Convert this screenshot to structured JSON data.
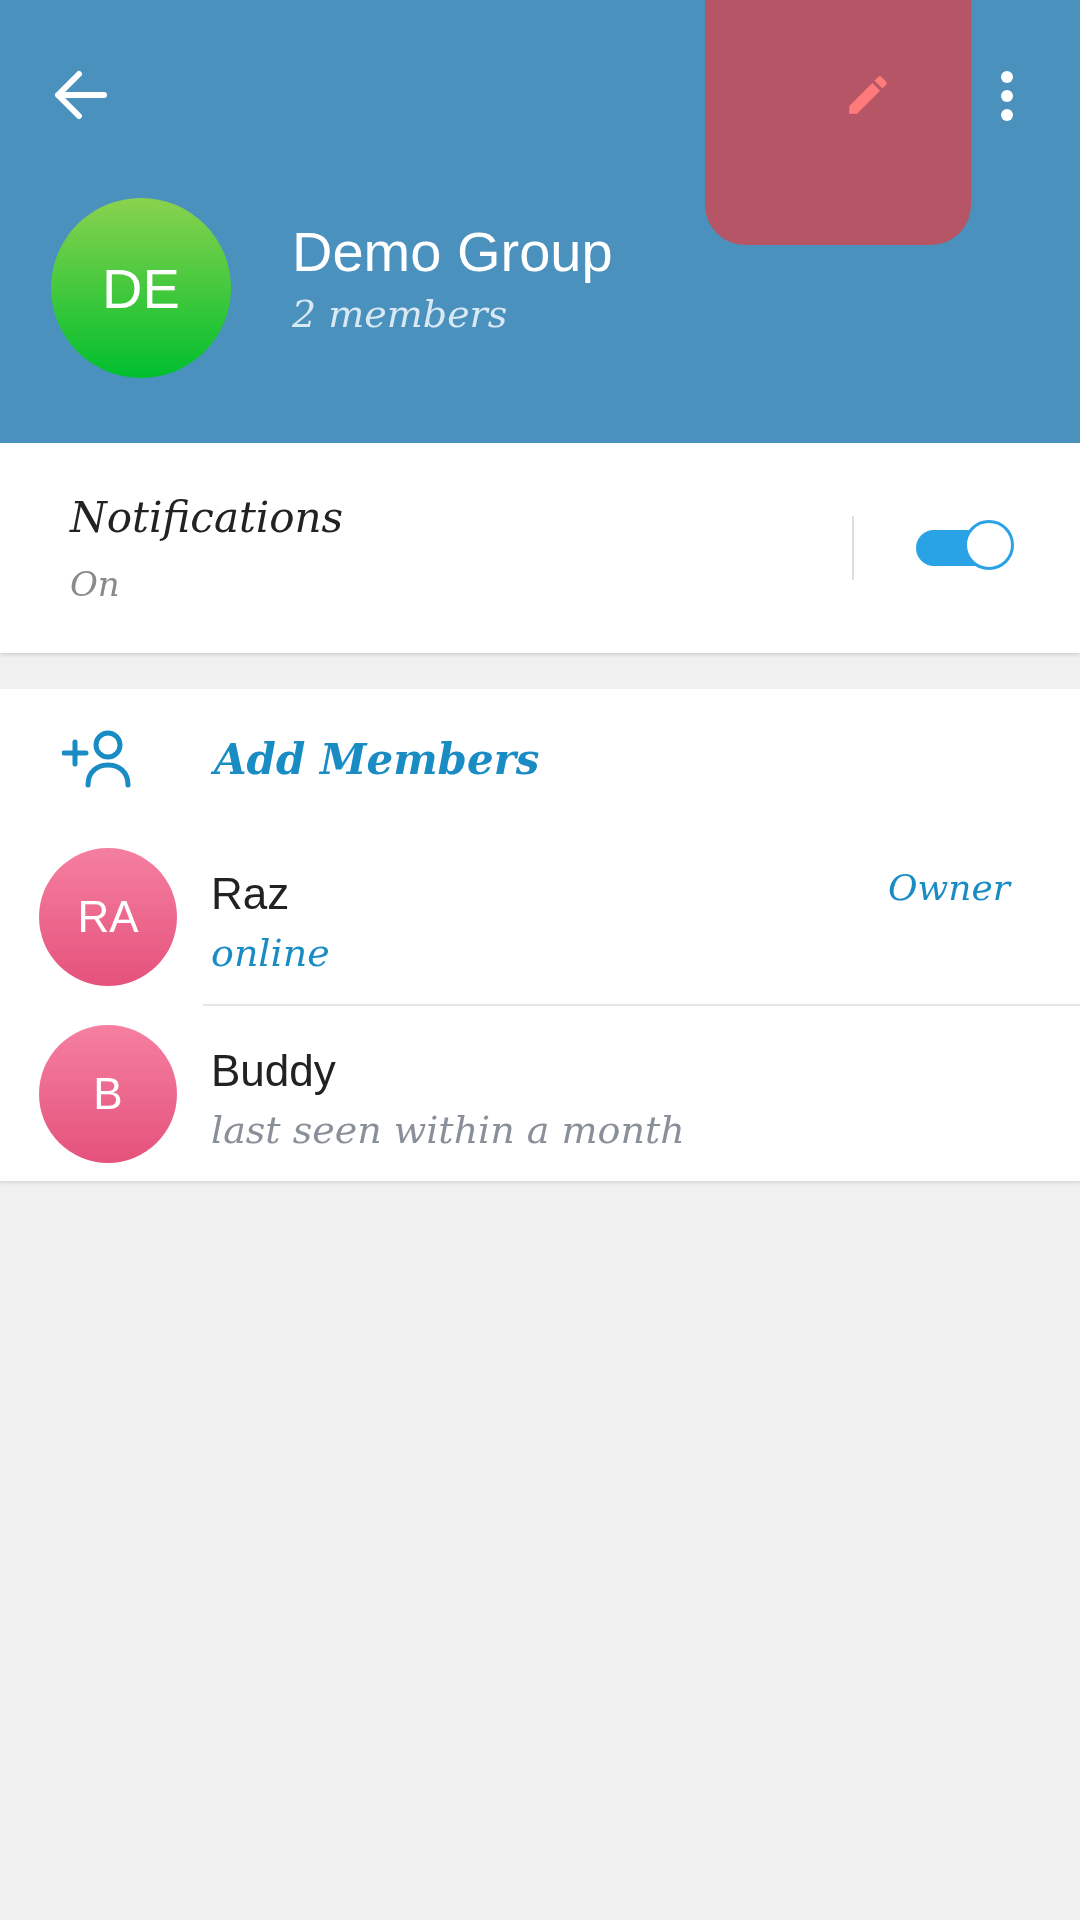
{
  "header": {
    "avatar_initials": "DE",
    "title": "Demo Group",
    "subtitle": "2 members"
  },
  "notifications": {
    "label": "Notifications",
    "value": "On",
    "on": true
  },
  "add_members": {
    "label": "Add Members"
  },
  "members": [
    {
      "initials": "RA",
      "name": "Raz",
      "status": "online",
      "online": true,
      "role": "Owner"
    },
    {
      "initials": "B",
      "name": "Buddy",
      "status": "last seen within a month",
      "online": false
    }
  ]
}
